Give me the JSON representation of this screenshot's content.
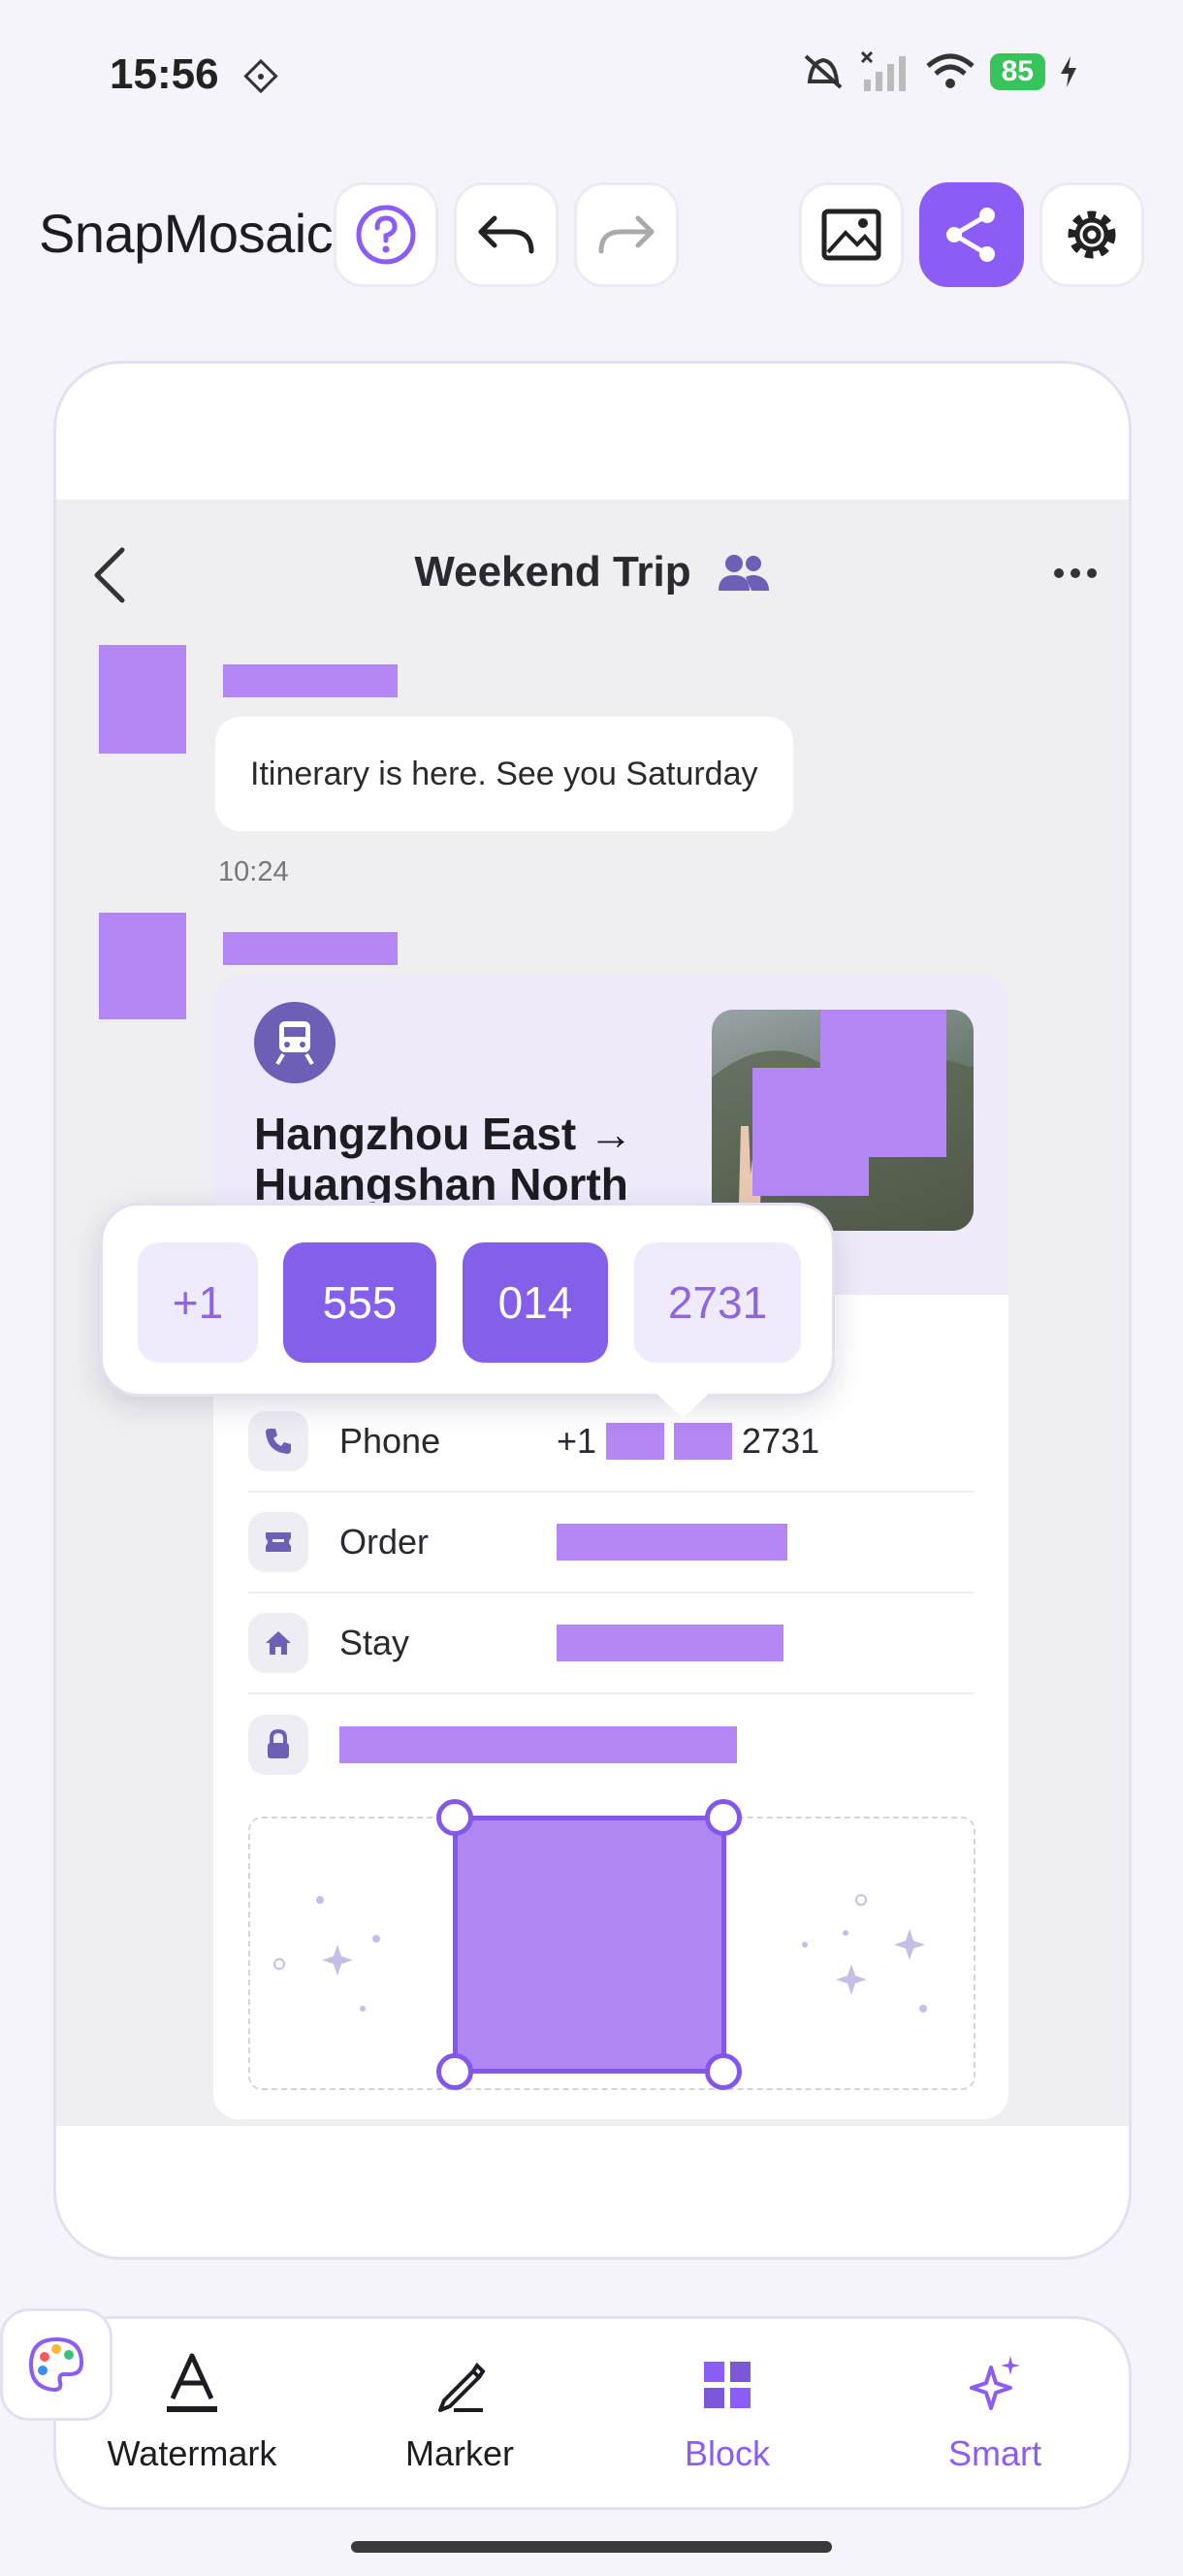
{
  "status": {
    "time": "15:56",
    "battery": "85"
  },
  "app": {
    "title": "SnapMosaic"
  },
  "chat": {
    "title": "Weekend Trip",
    "message": "Itinerary is here. See you Saturday",
    "timestamp": "10:24"
  },
  "ticket": {
    "route_line1": "Hangzhou East →",
    "route_line2": "Huangshan North",
    "rows": [
      {
        "label": "Phone",
        "prefix": "+1",
        "suffix": "2731"
      },
      {
        "label": "Order"
      },
      {
        "label": "Stay"
      }
    ]
  },
  "number_popover": {
    "segments": [
      "+1",
      "555",
      "014",
      "2731"
    ],
    "selected": [
      "555",
      "014"
    ]
  },
  "tools": [
    {
      "label": "Watermark",
      "icon": "text-a-icon"
    },
    {
      "label": "Marker",
      "icon": "pen-icon"
    },
    {
      "label": "Block",
      "icon": "block-grid-icon"
    },
    {
      "label": "Smart",
      "icon": "sparkle-icon"
    }
  ],
  "active_tool": "Block",
  "colors": {
    "accent": "#8b5cf6",
    "mosaic": "#b587f5"
  }
}
